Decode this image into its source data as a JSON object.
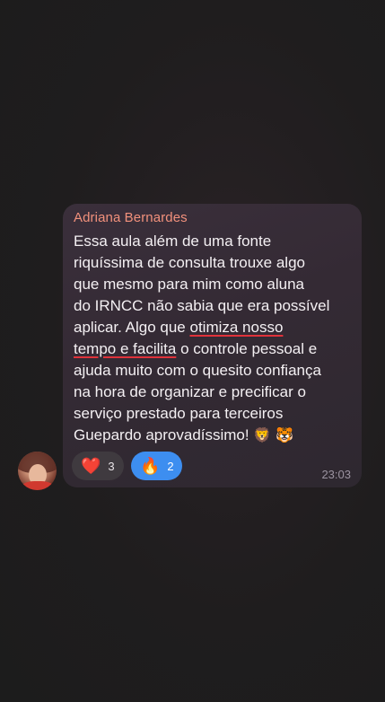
{
  "message": {
    "sender": "Adriana Bernardes",
    "lines": [
      "Essa aula além de uma fonte",
      "riquíssima de consulta trouxe algo",
      "que mesmo para mim como aluna",
      "do IRNCC não sabia que era possível",
      "aplicar. Algo que ",
      "otimiza nosso",
      "tempo e facilita",
      " o controle pessoal e",
      "ajuda muito com o quesito confiança",
      "na hora de organizar e precificar o",
      "serviço prestado para terceiros",
      "Guepardo aprovadíssimo! ",
      "🦁 🐯"
    ],
    "time": "23:03"
  },
  "reactions": [
    {
      "emoji": "❤️",
      "icon": "heart-icon",
      "count": "3"
    },
    {
      "emoji": "🔥",
      "icon": "fire-icon",
      "count": "2"
    }
  ],
  "colors": {
    "sender": "#f2917c",
    "underline": "#e0323a",
    "active_reaction": "#3d8ef0"
  }
}
